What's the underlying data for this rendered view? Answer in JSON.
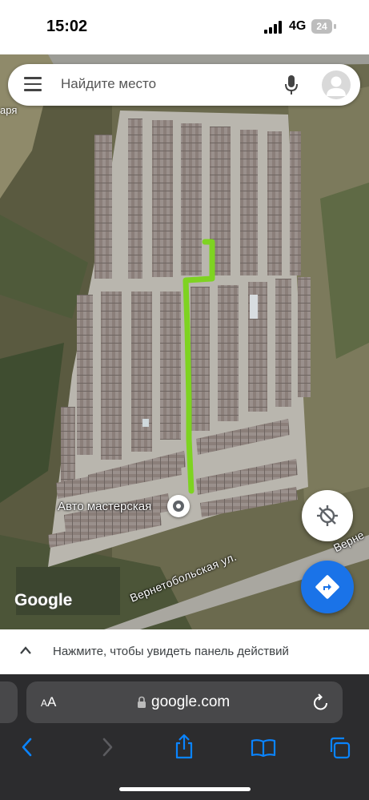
{
  "status_bar": {
    "time": "15:02",
    "network": "4G",
    "battery": "24"
  },
  "search": {
    "placeholder": "Найдите место"
  },
  "map": {
    "top_partial_label": "аря",
    "pin_label": "Авто мастерская",
    "street_label": "Вернетобольская ул.",
    "street_label_2": "Верне",
    "logo": "Google",
    "route_color": "#7ed321"
  },
  "action_panel": {
    "text": "Нажмите, чтобы увидеть панель действий"
  },
  "browser": {
    "reader_label_big": "A",
    "reader_label_small": "A",
    "url": "google.com"
  },
  "icons": [
    "menu-icon",
    "mic-icon",
    "avatar-icon",
    "location-icon",
    "directions-icon",
    "chevron-up-icon",
    "lock-icon",
    "reload-icon",
    "back-icon",
    "forward-icon",
    "share-icon",
    "bookmarks-icon",
    "tabs-icon"
  ],
  "colors": {
    "directions_button": "#1a73e8",
    "browser_bar": "#2c2c2e",
    "browser_accent": "#0a84ff"
  }
}
